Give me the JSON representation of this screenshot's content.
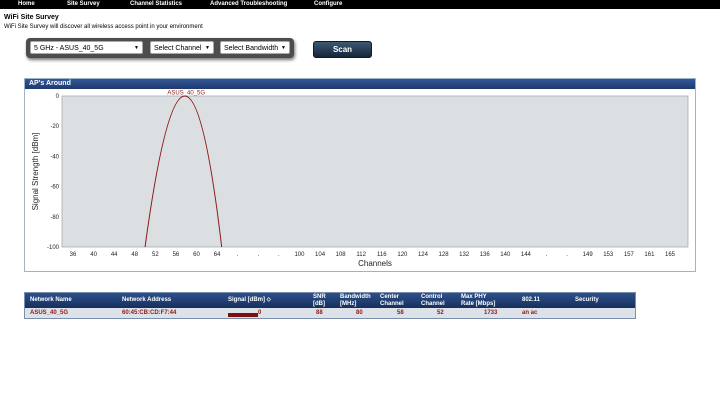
{
  "nav": {
    "items": [
      "Home",
      "Site Survey",
      "Channel Statistics",
      "Advanced Troubleshooting",
      "Configure"
    ]
  },
  "page": {
    "title": "WiFi Site Survey",
    "subtitle": "WiFi Site Survey will discover all wireless access point in your environment"
  },
  "controls": {
    "band_select": "5 GHz - ASUS_40_5G",
    "channel_select": "Select Channel",
    "bandwidth_select": "Select Bandwidth",
    "scan_label": "Scan"
  },
  "colors": {
    "nav_bg": "#000000",
    "header_blue": "#1e3a6d",
    "curve": "#8b1a1a",
    "plot_bg": "#dcdfe2"
  },
  "panel": {
    "title": "AP's Around"
  },
  "chart_data": {
    "type": "line",
    "title": "",
    "xlabel": "Channels",
    "ylabel": "Signal Strength [dBm]",
    "ylim": [
      -100,
      0
    ],
    "y_ticks": [
      "0",
      "-20",
      "-40",
      "-60",
      "-80",
      "-100"
    ],
    "x_ticks": [
      "36",
      "40",
      "44",
      "48",
      "52",
      "56",
      "60",
      "64",
      ".",
      ".",
      ".",
      "100",
      "104",
      "108",
      "112",
      "116",
      "120",
      "124",
      "128",
      "132",
      "136",
      "140",
      "144",
      ".",
      ".",
      "149",
      "153",
      "157",
      "161",
      "165"
    ],
    "series": [
      {
        "name": "ASUS_40_5G",
        "center_channel": 58,
        "span_start": 50,
        "span_end": 66,
        "peak": 0
      }
    ]
  },
  "table": {
    "headers": [
      [
        "Network Name"
      ],
      [
        "Network Address"
      ],
      [
        "Signal [dBm] ⬦"
      ],
      [
        "SNR",
        "[dB]"
      ],
      [
        "Bandwidth",
        "[MHz]"
      ],
      [
        "Center",
        "Channel"
      ],
      [
        "Control",
        "Channel"
      ],
      [
        "Max PHY",
        "Rate [Mbps]"
      ],
      [
        "802.11"
      ],
      [
        "Security"
      ]
    ],
    "rows": [
      {
        "name": "ASUS_40_5G",
        "address": "60:45:CB:CD:F7:44",
        "signal": "0",
        "snr": "88",
        "bandwidth": "80",
        "center": "58",
        "control": "52",
        "rate": "1733",
        "mode": "an ac",
        "security": ""
      }
    ]
  }
}
